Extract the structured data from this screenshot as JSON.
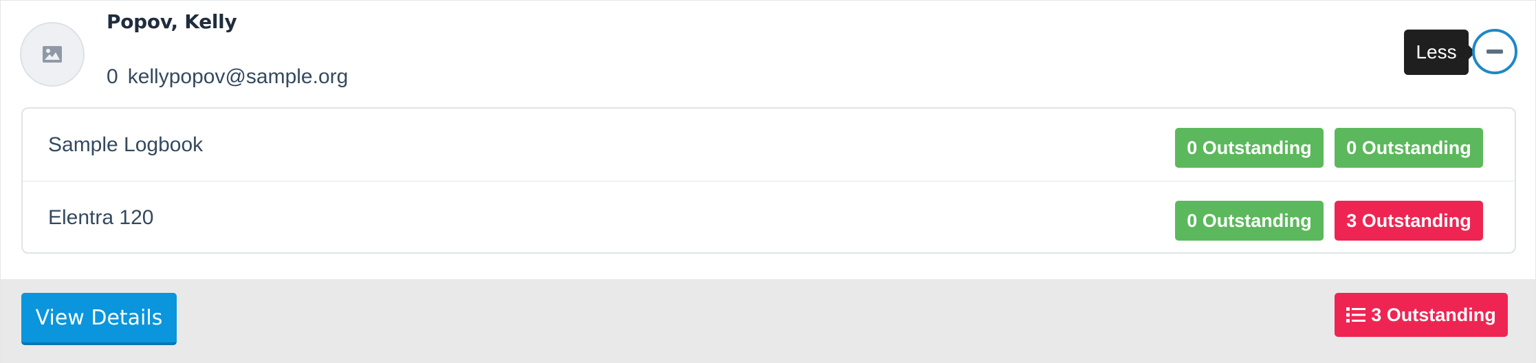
{
  "colors": {
    "accent": "#0a95dc",
    "success": "#5cb85c",
    "danger": "#ee2552",
    "tooltip_bg": "#1f1f1f",
    "footer_bg": "#e9e9e9"
  },
  "user": {
    "name": "Popov, Kelly",
    "count": "0",
    "email": "kellypopov@sample.org",
    "avatar_icon": "image-placeholder-icon"
  },
  "toggle": {
    "tooltip": "Less",
    "icon": "minus-icon"
  },
  "logbooks": [
    {
      "name": "Sample Logbook",
      "badge_1": "0 Outstanding",
      "badge_2": "0 Outstanding"
    },
    {
      "name": "Elentra 120",
      "badge_1": "0 Outstanding",
      "badge_2": "3 Outstanding"
    }
  ],
  "footer": {
    "view_details_label": "View Details",
    "total_outstanding": "3 Outstanding",
    "total_icon": "list-icon"
  }
}
